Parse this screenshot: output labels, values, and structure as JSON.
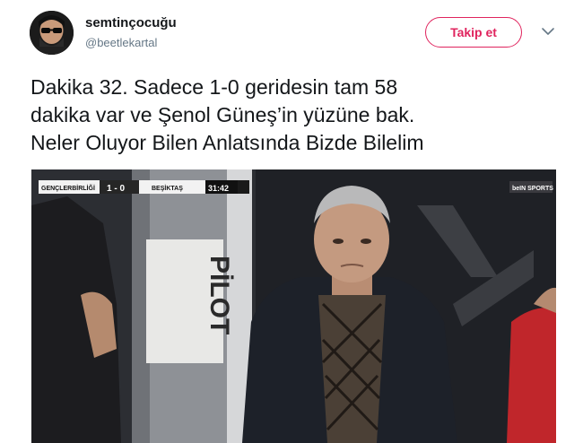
{
  "tweet": {
    "display_name": "semtinçocuğu",
    "handle": "@beetlekartal",
    "follow_label": "Takip et",
    "text_line_1": "Dakika 32. Sadece 1-0 geridesin tam 58",
    "text_line_2": "dakika var ve Şenol Güneş’in yüzüne bak.",
    "text_line_3": "Neler Oluyor Bilen Anlatsında Bizde Bilelim"
  },
  "media": {
    "scorebug": {
      "home_team": "GENÇLERBİRLİĞİ",
      "score": "1 - 0",
      "away_team": "BEŞİKTAŞ",
      "clock": "31:42"
    },
    "broadcaster_logo": "beIN SPORTS",
    "board_text": "PİLOT"
  },
  "colors": {
    "follow_accent": "#e0245e",
    "handle_gray": "#657786",
    "text": "#14171a"
  },
  "icons": {
    "more": "chevron-down-icon"
  }
}
